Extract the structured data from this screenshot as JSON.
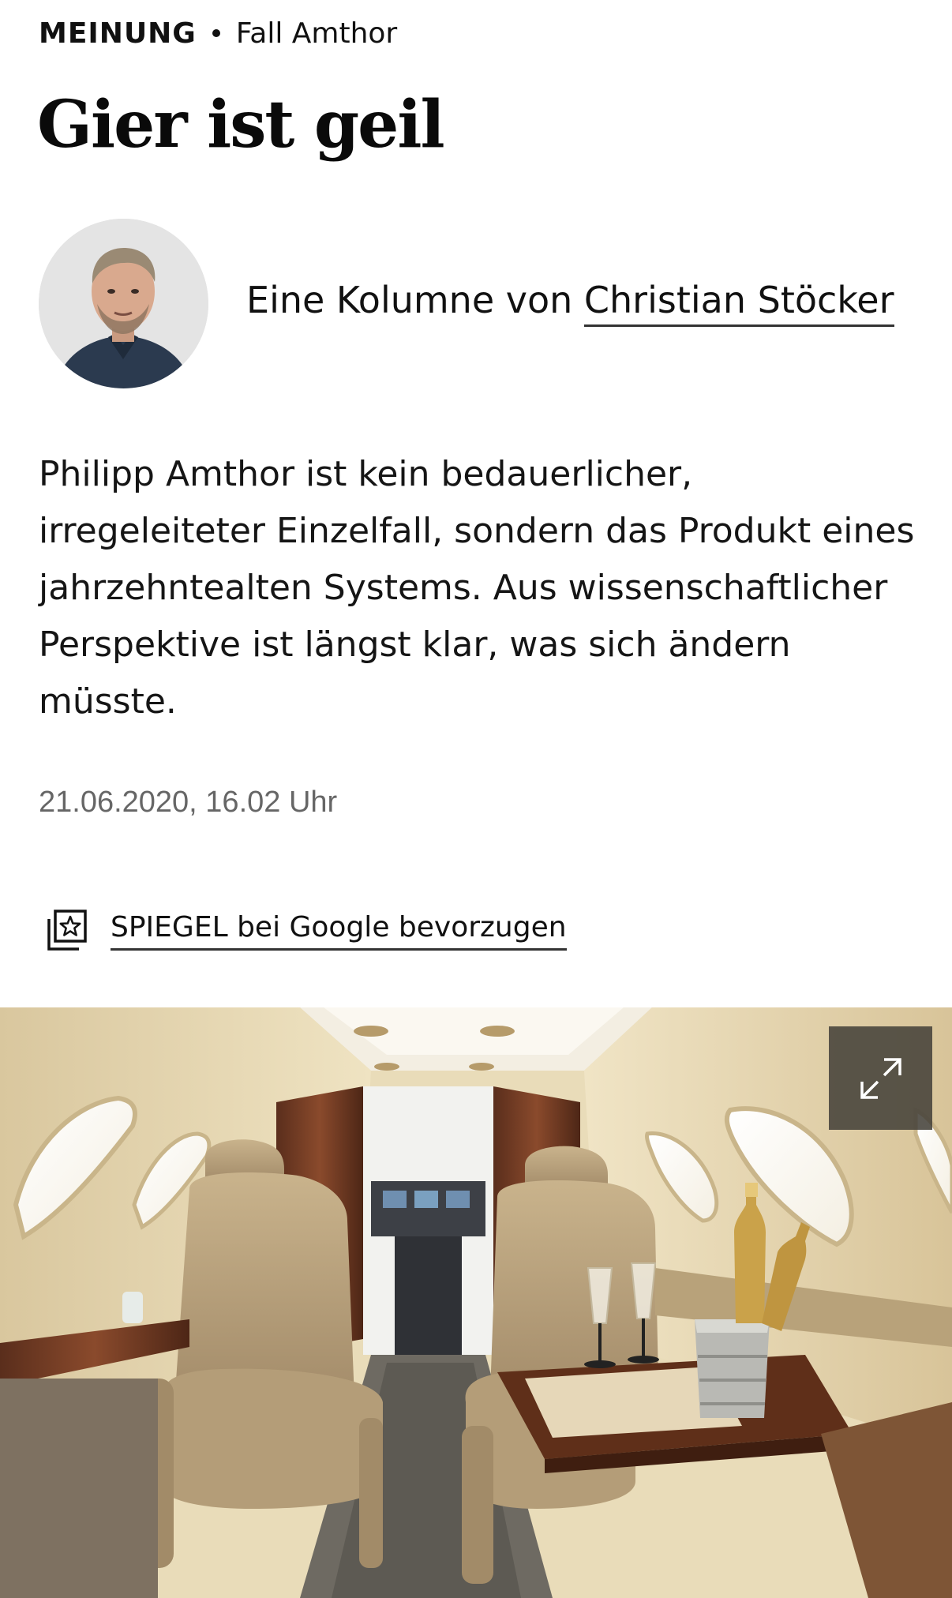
{
  "kicker": {
    "section": "MEINUNG",
    "topic": "Fall Amthor"
  },
  "headline": "Gier ist geil",
  "byline": {
    "prefix": "Eine Kolumne von ",
    "author": "Christian Stöcker"
  },
  "teaser": "Philipp Amthor ist kein bedauerlicher, irregeleiteter Einzelfall, sondern das Produkt eines jahrzehntealten Systems. Aus wissenschaftlicher Perspektive ist längst klar, was sich ändern müsste.",
  "date": "21.06.2020, 16.02 Uhr",
  "google_prefer": {
    "label": "SPIEGEL bei Google bevorzugen",
    "icon": "star-bookmark-icon"
  },
  "hero_image": {
    "subject": "private jet cabin with leather seats, champagne glasses and bottles",
    "expand_icon": "expand-icon"
  },
  "colors": {
    "text": "#111111",
    "meta": "#666666",
    "overlay_button": "#46423a"
  }
}
